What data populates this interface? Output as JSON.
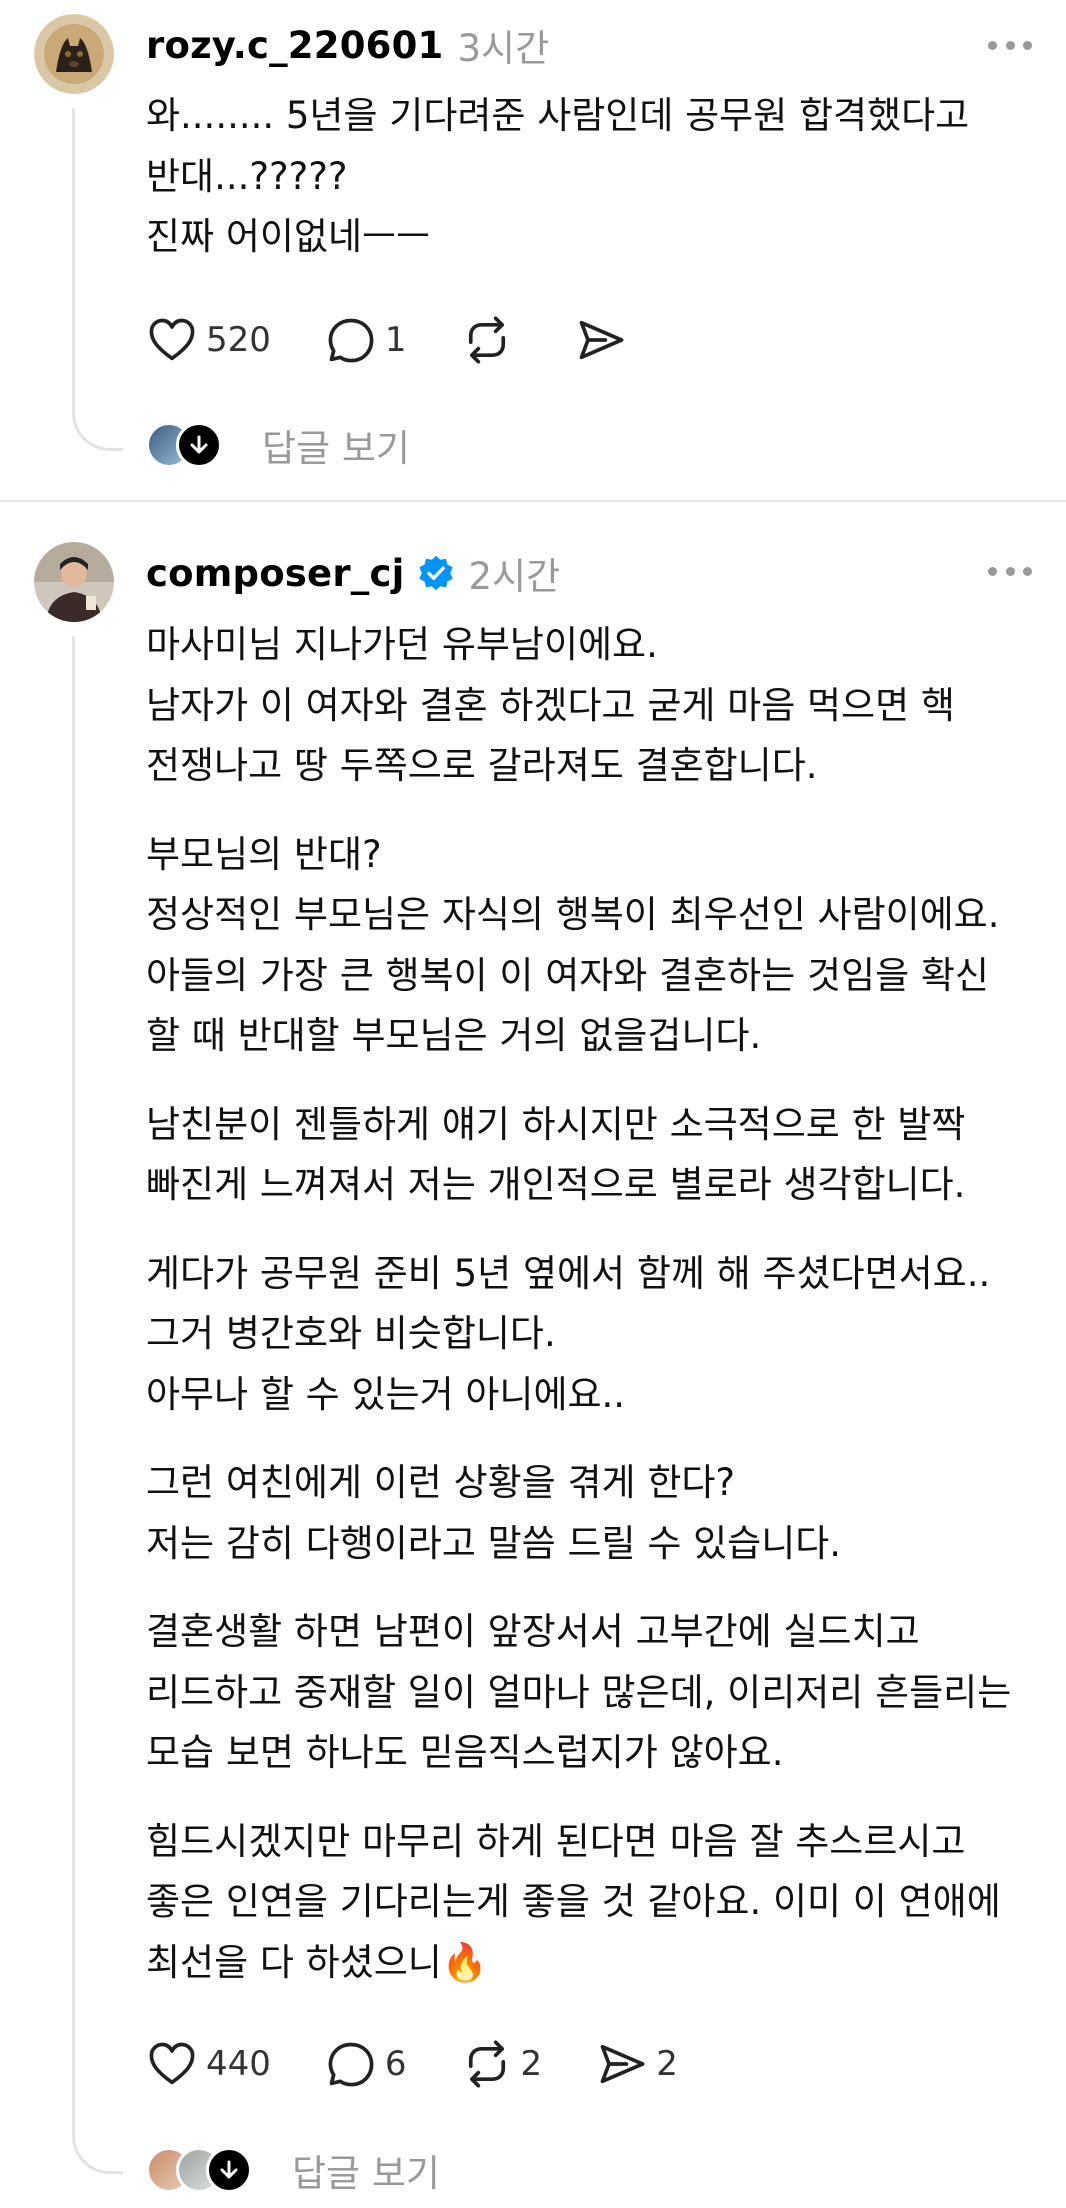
{
  "posts": [
    {
      "username": "rozy.c_220601",
      "time": "3시간",
      "verified": false,
      "body": [
        "와........ 5년을 기다려준 사람인데 공무원 합격했다고",
        "반대...?????",
        "진짜 어이없네ㅡㅡ"
      ],
      "likes": "520",
      "comments": "1",
      "reposts": "",
      "shares": "",
      "replies_label": "답글 보기"
    },
    {
      "username": "composer_cj",
      "time": "2시간",
      "verified": true,
      "paragraphs": [
        [
          "마사미님 지나가던 유부남이에요.",
          "남자가 이 여자와 결혼 하겠다고 굳게 마음 먹으면 핵",
          "전쟁나고 땅 두쪽으로 갈라져도 결혼합니다."
        ],
        [
          "부모님의 반대?",
          "정상적인 부모님은 자식의 행복이 최우선인 사람이에요.",
          "아들의 가장 큰 행복이 이 여자와 결혼하는 것임을 확신",
          "할 때 반대할 부모님은 거의 없을겁니다."
        ],
        [
          "남친분이 젠틀하게 얘기 하시지만 소극적으로 한 발짝",
          "빠진게 느껴져서 저는 개인적으로 별로라 생각합니다."
        ],
        [
          "게다가 공무원 준비 5년 옆에서 함께 해 주셨다면서요..",
          "그거 병간호와 비슷합니다.",
          "아무나 할 수 있는거 아니에요.."
        ],
        [
          "그런 여친에게 이런 상황을 겪게 한다?",
          "저는 감히 다행이라고 말씀 드릴 수 있습니다."
        ],
        [
          "결혼생활 하면 남편이 앞장서서 고부간에 실드치고",
          "리드하고 중재할 일이 얼마나 많은데, 이리저리 흔들리는",
          "모습 보면 하나도 믿음직스럽지가 않아요."
        ],
        [
          "힘드시겠지만 마무리 하게 된다면 마음 잘 추스르시고",
          "좋은 인연을 기다리는게 좋을 것 같아요. 이미 이 연애에",
          "최선을 다 하셨으니🔥"
        ]
      ],
      "likes": "440",
      "comments": "6",
      "reposts": "2",
      "shares": "2",
      "replies_label": "답글 보기"
    }
  ],
  "colors": {
    "text": "#111111",
    "muted": "#999999",
    "verified": "#0095f6",
    "divider": "#e6e6e6"
  },
  "icons": [
    "heart-icon",
    "comment-icon",
    "repost-icon",
    "share-icon",
    "more-icon",
    "verified-badge-icon",
    "chevron-down-icon"
  ]
}
